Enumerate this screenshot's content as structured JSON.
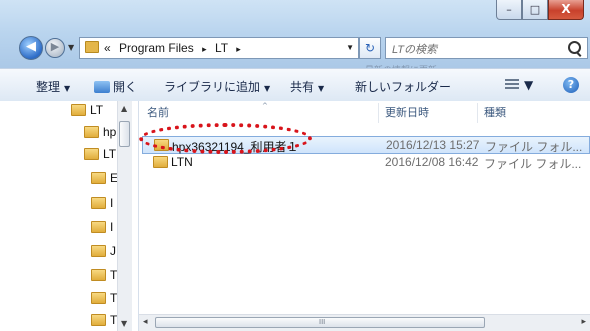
{
  "window": {
    "caption_buttons": {
      "minimize": "–",
      "maximize": "□",
      "close": "X"
    }
  },
  "navigation": {
    "back_arrow": "◀",
    "forward_arrow": "▶",
    "recent_dropdown": "▼",
    "address": {
      "overflow": "«",
      "crumbs": [
        "Program Files",
        "LT"
      ],
      "separator": "▸",
      "dropdown": "▼"
    },
    "refresh": "↻",
    "search_placeholder": "LTの検索",
    "ghost_tooltip": "最新の情報に更新"
  },
  "toolbar": {
    "organize": "整理",
    "open": "開く",
    "add_to_library": "ライブラリに追加",
    "share": "共有",
    "new_folder": "新しいフォルダー",
    "dropdown": "▼",
    "help": "?"
  },
  "nav_pane": {
    "items": [
      "LT",
      "hp",
      "LT",
      "E",
      "I",
      "I",
      "J",
      "T",
      "T",
      "T"
    ],
    "scroll_up": "▲",
    "scroll_down": "▼"
  },
  "columns": {
    "name": "名前",
    "modified": "更新日時",
    "type": "種類",
    "sort_indicator": "^"
  },
  "files": [
    {
      "name": "hpx36321194_利用者１",
      "modified": "2016/12/13 15:27",
      "type": "ファイル フォル...",
      "selected": true
    },
    {
      "name": "LTN",
      "modified": "2016/12/08 16:42",
      "type": "ファイル フォル...",
      "selected": false
    }
  ],
  "scrollbar": {
    "left": "◂",
    "right": "▸",
    "grip": "III"
  },
  "colors": {
    "highlight_ring": "#d8141b",
    "selection": "#cfe4fb"
  }
}
